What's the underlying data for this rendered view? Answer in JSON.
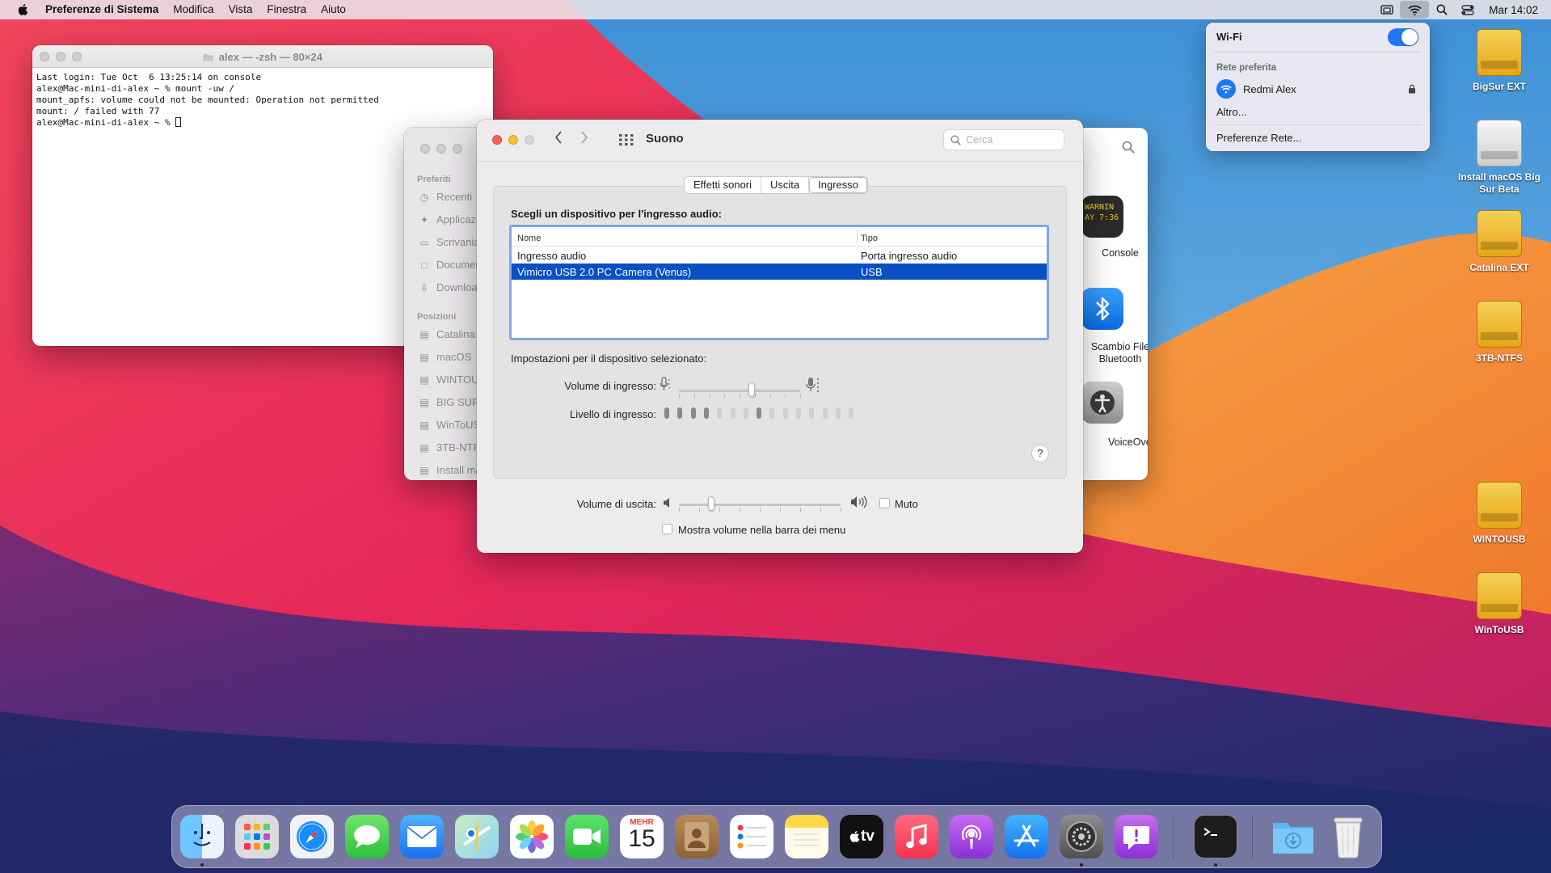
{
  "menubar": {
    "app_name": "Preferenze di Sistema",
    "items": [
      "Modifica",
      "Vista",
      "Finestra",
      "Aiuto"
    ],
    "clock": "Mar 14:02",
    "icons": [
      "screen-mirror-icon",
      "wifi-icon",
      "spotlight-search-icon",
      "control-center-icon"
    ]
  },
  "terminal": {
    "title": "alex — -zsh — 80×24",
    "lines": [
      "Last login: Tue Oct  6 13:25:14 on console",
      "alex@Mac-mini-di-alex ~ % mount -uw /",
      "mount_apfs: volume could not be mounted: Operation not permitted",
      "mount: / failed with 77",
      "alex@Mac-mini-di-alex ~ % "
    ]
  },
  "finder": {
    "sections": [
      "Preferiti",
      "Posizioni"
    ],
    "favorites": [
      "Recenti",
      "Applicazioni",
      "Scrivania",
      "Documenti",
      "Download"
    ],
    "locations": [
      "Catalina",
      "macOS",
      "WINTOUSB",
      "BIG SUR",
      "WinToUSB",
      "3TB-NTFS",
      "Install macOS"
    ],
    "apps": [
      {
        "label": "Console",
        "tile_text": "WARNIN\nAY 7:36"
      },
      {
        "label": "Scambio File\nBluetooth"
      },
      {
        "label": "VoiceOver"
      }
    ]
  },
  "sound": {
    "title": "Suono",
    "search_placeholder": "Cerca",
    "tabs": [
      "Effetti sonori",
      "Uscita",
      "Ingresso"
    ],
    "selected_tab": "Ingresso",
    "choose_label": "Scegli un dispositivo per l'ingresso audio:",
    "table": {
      "headers": [
        "Nome",
        "Tipo"
      ],
      "rows": [
        {
          "name": "Ingresso audio",
          "type": "Porta ingresso audio",
          "selected": false
        },
        {
          "name": "Vimicro USB 2.0 PC Camera (Venus)",
          "type": "USB",
          "selected": true
        }
      ]
    },
    "settings_label": "Impostazioni per il dispositivo selezionato:",
    "input_volume_label": "Volume di ingresso:",
    "input_volume": 0.6,
    "input_level_label": "Livello di ingresso:",
    "input_level_segments": 15,
    "input_level_active": 4,
    "output_volume_label": "Volume di uscita:",
    "output_volume": 0.2,
    "mute_label": "Muto",
    "show_volume_label": "Mostra volume nella barra dei menu",
    "help": "?"
  },
  "wifi_menu": {
    "title": "Wi-Fi",
    "enabled": true,
    "preferred_header": "Rete preferita",
    "network": "Redmi Alex",
    "other": "Altro...",
    "preferences": "Preferenze Rete..."
  },
  "desktop_icons": [
    {
      "label": "BigSur EXT",
      "style": "orange"
    },
    {
      "label": "Install macOS Big Sur Beta",
      "style": "silver"
    },
    {
      "label": "Catalina EXT",
      "style": "orange"
    },
    {
      "label": "3TB-NTFS",
      "style": "orange"
    },
    {
      "label": "WINTOUSB",
      "style": "orange"
    },
    {
      "label": "WinToUSB",
      "style": "orange"
    }
  ],
  "dock": {
    "calendar_month": "MEHR",
    "calendar_day": "15",
    "apps": [
      "Finder",
      "Launchpad",
      "Safari",
      "Messaggi",
      "Mail",
      "Mappe",
      "Foto",
      "FaceTime",
      "Calendario",
      "Contatti",
      "Promemoria",
      "Note",
      "TV",
      "Musica",
      "Podcast",
      "App Store",
      "Preferenze di Sistema",
      "Feedback Assistant",
      "Terminale",
      "Download",
      "Cestino"
    ],
    "tv_label": "tv"
  },
  "colors": {
    "accent": "#0a4fc4",
    "wifi_blue": "#1e78f4",
    "close": "#ff5f57",
    "minimize": "#febc2e"
  }
}
